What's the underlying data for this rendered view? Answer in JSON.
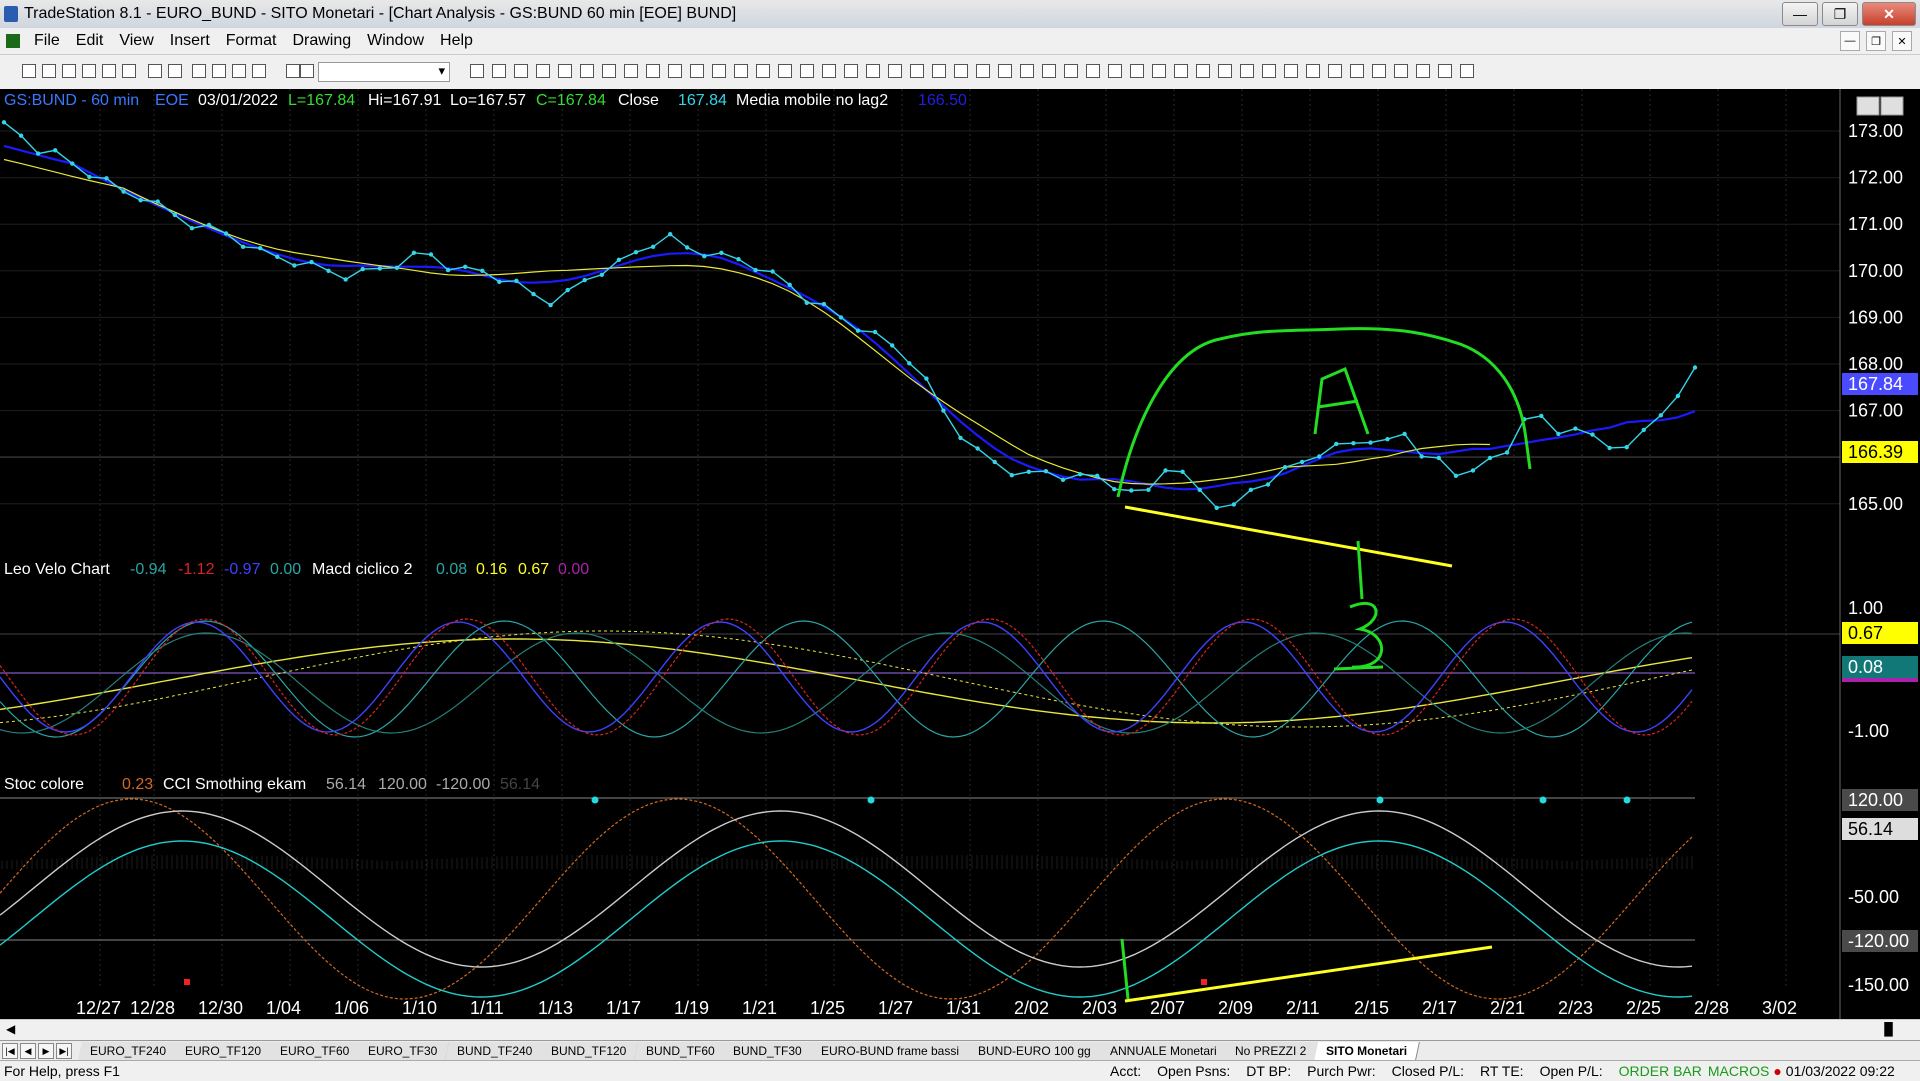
{
  "window": {
    "title": "TradeStation 8.1 - EURO_BUND - SITO Monetari - [Chart Analysis - GS:BUND  60 min  [EOE] BUND]",
    "min": "—",
    "max": "❐",
    "close": "✕"
  },
  "menu": [
    "File",
    "Edit",
    "View",
    "Insert",
    "Format",
    "Drawing",
    "Window",
    "Help"
  ],
  "header": {
    "symbol": "GS:BUND - 60 min",
    "exchange": "EOE",
    "date": "03/01/2022",
    "last": "L=167.84",
    "high": "Hi=167.91",
    "low": "Lo=167.57",
    "close": "C=167.84",
    "close_label": "Close",
    "close_value": "167.84",
    "ma_label": "Media mobile no lag2",
    "ma_value": "166.50"
  },
  "panel2_header": {
    "name": "Leo Velo Chart",
    "v1": "-0.94",
    "v2": "-1.12",
    "v3": "-0.97",
    "v4": "0.00",
    "name2": "Macd ciclico 2",
    "v5": "0.08",
    "v6": "0.16",
    "v7": "0.67",
    "v8": "0.00"
  },
  "panel3_header": {
    "name": "Stoc colore",
    "v1": "0.23",
    "name2": "CCI Smothing ekam",
    "v2": "56.14",
    "v3": "120.00",
    "v4": "-120.00",
    "v5": "56.14"
  },
  "price_axis": [
    "173.00",
    "172.00",
    "171.00",
    "170.00",
    "169.00",
    "168.00",
    "167.00",
    "166.00",
    "165.00"
  ],
  "price_badges": {
    "last": "167.84",
    "ma": "166.39"
  },
  "osc_axis": [
    "1.00",
    "-1.00"
  ],
  "osc_badges": {
    "a": "0.67",
    "b": "0.08"
  },
  "cci_axis": [
    "120.00",
    "56.14",
    "-50.00",
    "-120.00",
    "-150.00"
  ],
  "date_axis": [
    "12/27",
    "12/28",
    "12/30",
    "1/04",
    "1/06",
    "1/10",
    "1/11",
    "1/13",
    "1/17",
    "1/19",
    "1/21",
    "1/25",
    "1/27",
    "1/31",
    "2/02",
    "2/03",
    "2/07",
    "2/09",
    "2/11",
    "2/15",
    "2/17",
    "2/21",
    "2/23",
    "2/25",
    "2/28",
    "3/02"
  ],
  "annotations": {
    "a": "A",
    "b": "B"
  },
  "tabs": [
    "EURO_TF240",
    "EURO_TF120",
    "EURO_TF60",
    "EURO_TF30",
    "BUND_TF240",
    "BUND_TF120",
    "BUND_TF60",
    "BUND_TF30",
    "EURO-BUND frame bassi",
    "BUND-EURO 100 gg",
    "ANNUALE Monetari",
    "No PREZZI 2",
    "SITO Monetari"
  ],
  "active_tab": "SITO Monetari",
  "status": {
    "help": "For Help, press F1",
    "acct": "Acct:",
    "open_psns": "Open Psns:",
    "dt_bp": "DT BP:",
    "purch": "Purch Pwr:",
    "closed_pl": "Closed P/L:",
    "rt_te": "RT TE:",
    "open_pl": "Open P/L:",
    "order_bar": "ORDER BAR",
    "macros": "MACROS",
    "datetime": "01/03/2022 09:22"
  },
  "colors": {
    "price": "#33d6e8",
    "ma_blue": "#1a1aff",
    "ma_yellow": "#e8e83a",
    "annot_green": "#22dd22",
    "annot_yellow": "#ffff22",
    "grid": "#333333",
    "badge_blue": "#4a4aff",
    "badge_yellow": "#ffff00",
    "badge_teal": "#117777",
    "badge_grey": "#4a4a4a"
  },
  "chart_data": {
    "type": "line",
    "series": [
      {
        "name": "GS:BUND - 60 min",
        "values": [
          173.1,
          172.9,
          172.6,
          172.5,
          172.3,
          172.1,
          171.9,
          171.7,
          171.6,
          171.4,
          171.2,
          171.0,
          170.9,
          170.8,
          170.6,
          170.4,
          170.3,
          170.2,
          170.1,
          170.0,
          169.9,
          169.95,
          170.05,
          170.15,
          170.3,
          170.35,
          170.1,
          170.0,
          170.0,
          169.85,
          169.7,
          169.5,
          169.35,
          169.5,
          169.8,
          170.0,
          170.15,
          170.4,
          170.6,
          170.7,
          170.5,
          170.4,
          170.3,
          170.25,
          170.1,
          169.9,
          169.7,
          169.4,
          169.2,
          169.0,
          168.8,
          168.6,
          168.4,
          168.1,
          167.6,
          167.0,
          166.5,
          166.1,
          165.9,
          165.7,
          165.6,
          165.7,
          165.6,
          165.55,
          165.6,
          165.4,
          165.2,
          165.3,
          165.8,
          165.6,
          165.3,
          165.0,
          164.9,
          165.3,
          165.5,
          165.7,
          165.9,
          166.1,
          166.2,
          166.3,
          166.4,
          166.3,
          166.5,
          166.1,
          165.9,
          165.6,
          165.8,
          165.9,
          166.1,
          166.9,
          166.8,
          166.5,
          166.7,
          166.4,
          166.2,
          166.3,
          166.5,
          166.9,
          167.4,
          167.84
        ]
      },
      {
        "name": "Media mobile no lag2",
        "values": [
          173.0,
          171.8,
          170.8,
          170.1,
          170.3,
          170.6,
          169.8,
          167.0,
          165.6,
          165.3,
          166.0,
          166.5
        ]
      }
    ],
    "y_range": [
      164.5,
      173.5
    ]
  }
}
